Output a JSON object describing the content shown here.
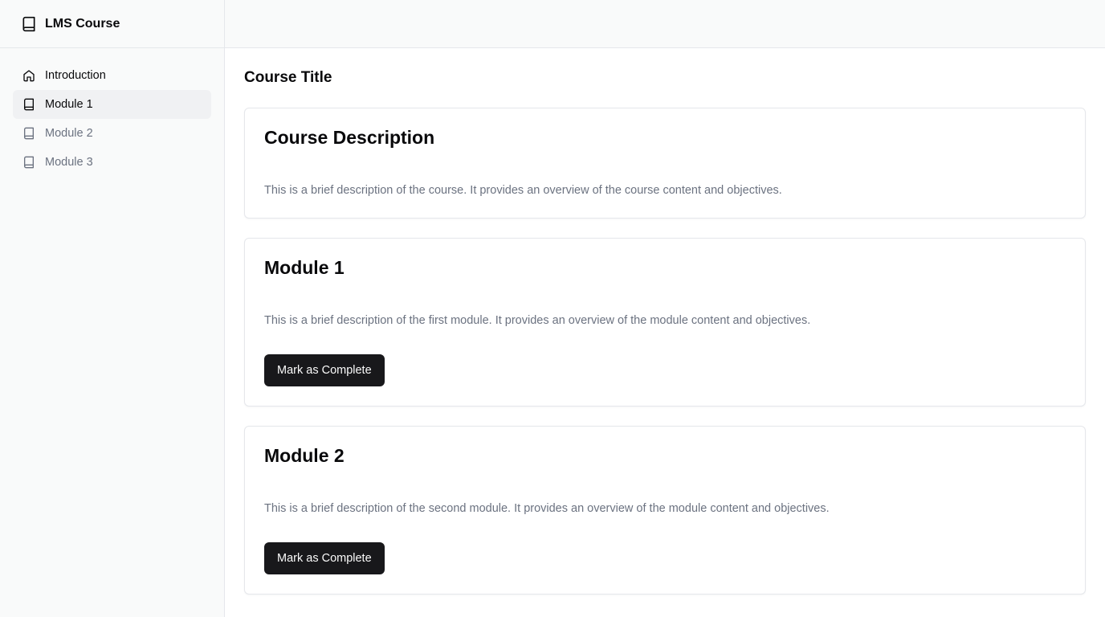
{
  "app": {
    "brand_title": "LMS Course"
  },
  "sidebar": {
    "items": [
      {
        "label": "Introduction",
        "icon": "home-icon"
      },
      {
        "label": "Module 1",
        "icon": "book-icon"
      },
      {
        "label": "Module 2",
        "icon": "book-icon"
      },
      {
        "label": "Module 3",
        "icon": "book-icon"
      }
    ]
  },
  "main": {
    "page_title": "Course Title",
    "cards": [
      {
        "title": "Course Description",
        "text": "This is a brief description of the course. It provides an overview of the course content and objectives."
      },
      {
        "title": "Module 1",
        "text": "This is a brief description of the first module. It provides an overview of the module content and objectives.",
        "button_label": "Mark as Complete"
      },
      {
        "title": "Module 2",
        "text": "This is a brief description of the second module. It provides an overview of the module content and objectives.",
        "button_label": "Mark as Complete"
      }
    ]
  },
  "colors": {
    "sidebar_bg": "#f9fafa",
    "active_item_bg": "#f0f1f3",
    "button_bg": "#18181b",
    "muted_text": "#6b7280",
    "border": "#e5e7eb"
  }
}
